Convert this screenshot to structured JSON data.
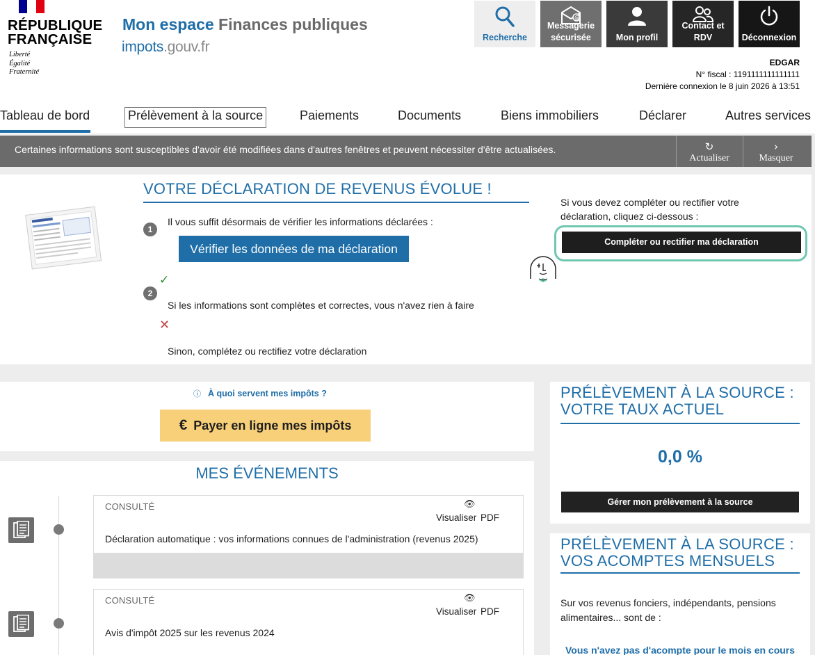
{
  "header": {
    "rf_name": "RÉPUBLIQUE\nFRANÇAISE",
    "rf_motto": "Liberté\nÉgalité\nFraternité",
    "site_title_1": "Mon espace",
    "site_title_2": "Finances publiques",
    "domain_1": "impots",
    "domain_2": ".gouv.fr",
    "buttons": {
      "search": "Recherche",
      "messaging_1": "Messagerie",
      "messaging_2": "sécurisée",
      "profile": "Mon profil",
      "contact_1": "Contact et",
      "contact_2": "RDV",
      "logout": "Déconnexion"
    },
    "user": {
      "name": "EDGAR",
      "fiscal": "N° fiscal :  1191111111111111",
      "last_login": "Dernière connexion le 8 juin 2026 à 13:51"
    }
  },
  "nav": {
    "items": [
      "Tableau de bord",
      "Prélèvement à la source",
      "Paiements",
      "Documents",
      "Biens immobiliers",
      "Déclarer",
      "Autres services"
    ]
  },
  "alert": {
    "text": "Certaines informations sont susceptibles d'avoir été modifiées dans d'autres fenêtres et peuvent nécessiter d'être actualisées.",
    "refresh": "Actualiser",
    "hide": "Masquer"
  },
  "declaration": {
    "title": "VOTRE DÉCLARATION DE REVENUS ÉVOLUE !",
    "step1_num": "1",
    "step1_text": "Il vous suffit désormais de vérifier les informations déclarées :",
    "verify_button": "Vérifier les données de ma déclaration",
    "step2_num": "2",
    "ok_text": "Si les informations sont complètes et correctes, vous n'avez rien à faire",
    "ko_text": "Sinon, complétez ou rectifiez votre déclaration",
    "right_text": "Si vous devez compléter ou rectifier votre déclaration, cliquez ci-dessous :",
    "complete_button": "Compléter ou rectifier ma déclaration"
  },
  "pay": {
    "info_link": "À quoi servent mes impôts ?",
    "pay_button": "Payer en ligne mes impôts"
  },
  "events": {
    "title": "MES ÉVÉNEMENTS",
    "items": [
      {
        "status": "CONSULTÉ",
        "view": "Visualiser",
        "pdf": "PDF",
        "desc": "Déclaration automatique : vos informations connues de l'administration (revenus 2025)"
      },
      {
        "status": "CONSULTÉ",
        "view": "Visualiser",
        "pdf": "PDF",
        "desc": "Avis d'impôt 2025 sur les revenus 2024"
      }
    ]
  },
  "rate": {
    "title": "PRÉLÈVEMENT À LA SOURCE : VOTRE TAUX ACTUEL",
    "value": "0,0 %",
    "manage_button": "Gérer mon prélèvement à la source"
  },
  "acomptes": {
    "title": "PRÉLÈVEMENT À LA SOURCE : VOS ACOMPTES MENSUELS",
    "text": "Sur vos revenus fonciers, indépendants, pensions alimentaires... sont de :",
    "note": "Vous n'avez pas d'acompte pour le mois en cours"
  },
  "icons": {
    "search": "search-icon",
    "messaging": "envelope-icon",
    "profile": "user-icon",
    "contact": "users-icon",
    "logout": "power-icon",
    "refresh": "refresh-icon",
    "hide": "chevron-right-icon",
    "check": "check-icon",
    "cross": "cross-icon",
    "info": "info-icon",
    "euro": "euro-icon",
    "eye": "eye-icon",
    "document": "document-icon"
  },
  "colors": {
    "primary_blue": "#1f6ea8",
    "pay_yellow": "#f8d07a",
    "highlight_green": "#6ec7b0"
  }
}
